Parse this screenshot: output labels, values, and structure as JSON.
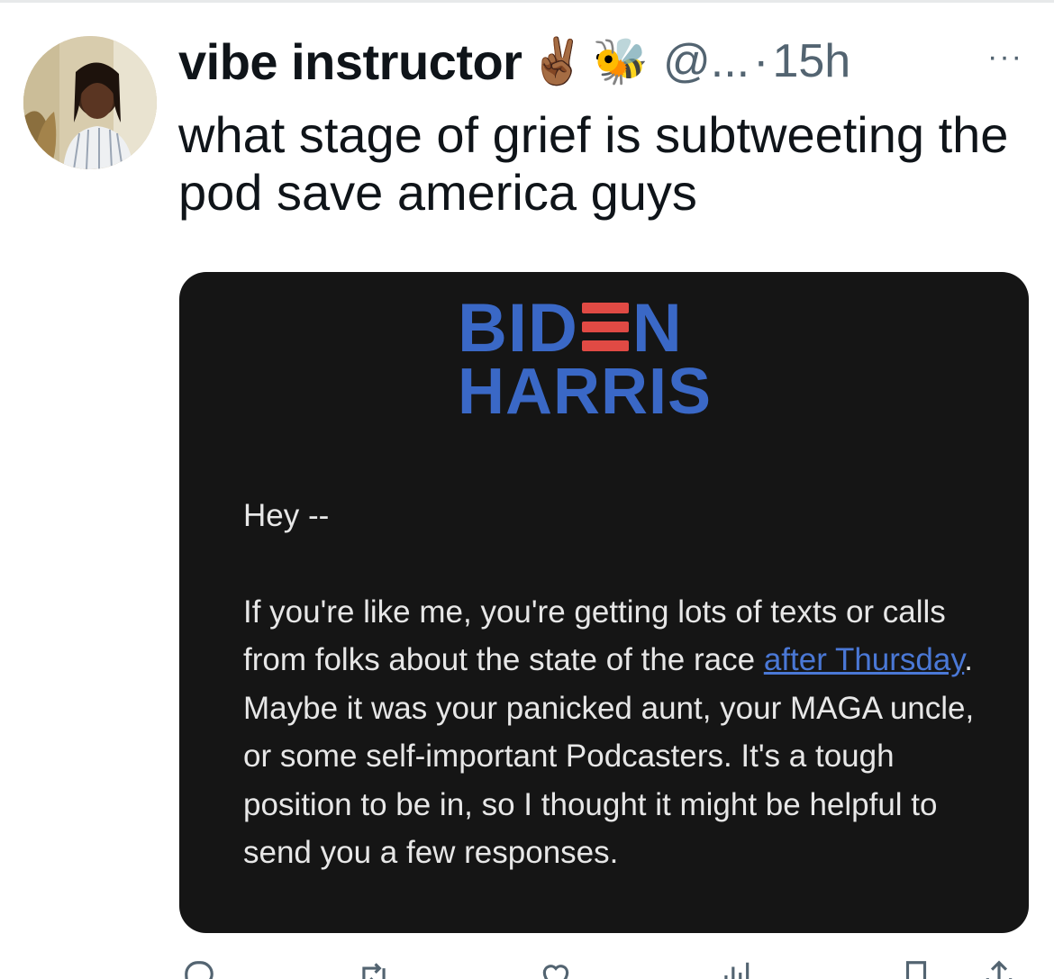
{
  "tweet": {
    "display_name": "vibe instructor",
    "emojis": [
      "✌🏾",
      "🐝"
    ],
    "handle": "@...",
    "separator": "·",
    "timestamp": "15h",
    "more": "···",
    "text": "what stage of grief is subtweeting the pod save america guys"
  },
  "media": {
    "logo": {
      "line1_left": "BID",
      "line1_right": "N",
      "line2": "HARRIS"
    },
    "greeting": "Hey --",
    "body_before_link": "If you're like me, you're getting lots of texts or calls from folks about the state of the race ",
    "link_text": "after Thursday",
    "body_after_link": ". Maybe it was your panicked aunt, your MAGA uncle, or some self-important Podcasters. It's a tough position to be in, so I thought it might be helpful to send you a few responses."
  },
  "colors": {
    "text_primary": "#0f1419",
    "text_secondary": "#536471",
    "media_background": "#151515",
    "logo_blue": "#3a68c6",
    "logo_red": "#e04a44",
    "link_blue": "#4a78d6"
  },
  "actions": [
    {
      "icon": "reply-icon"
    },
    {
      "icon": "retweet-icon"
    },
    {
      "icon": "like-icon"
    },
    {
      "icon": "views-icon"
    },
    {
      "icon": "bookmark-icon"
    },
    {
      "icon": "share-icon"
    }
  ]
}
